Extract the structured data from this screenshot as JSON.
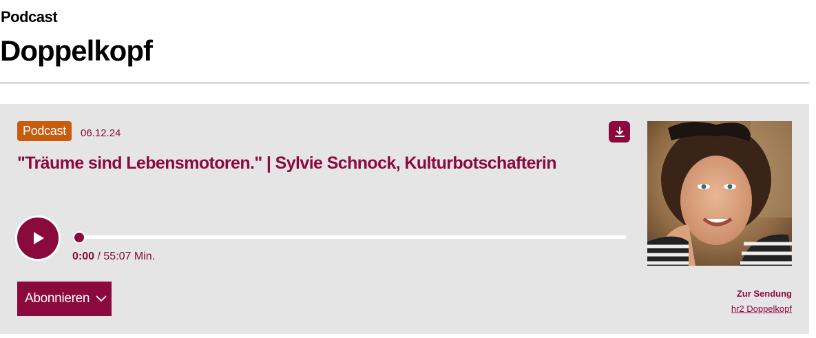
{
  "header": {
    "eyebrow": "Podcast",
    "title": "Doppelkopf"
  },
  "episode": {
    "badge": "Podcast",
    "date": "06.12.24",
    "title": "\"Träume sind Lebensmotoren.\" | Sylvie Schnock, Kulturbotschafterin",
    "download_icon": "download-icon",
    "image_alt": "Sylvie Schnock"
  },
  "player": {
    "current_time": "0:00",
    "separator": "/",
    "duration": "55:07 Min.",
    "progress": 0,
    "play_icon": "play-icon"
  },
  "actions": {
    "subscribe_label": "Abonnieren",
    "subscribe_icon": "chevron-down-icon",
    "show_label": "Zur Sendung",
    "show_link": "hr2 Doppelkopf"
  },
  "colors": {
    "accent": "#8a0a3e",
    "badge": "#c65c0d",
    "card_bg": "#e6e5e5"
  }
}
